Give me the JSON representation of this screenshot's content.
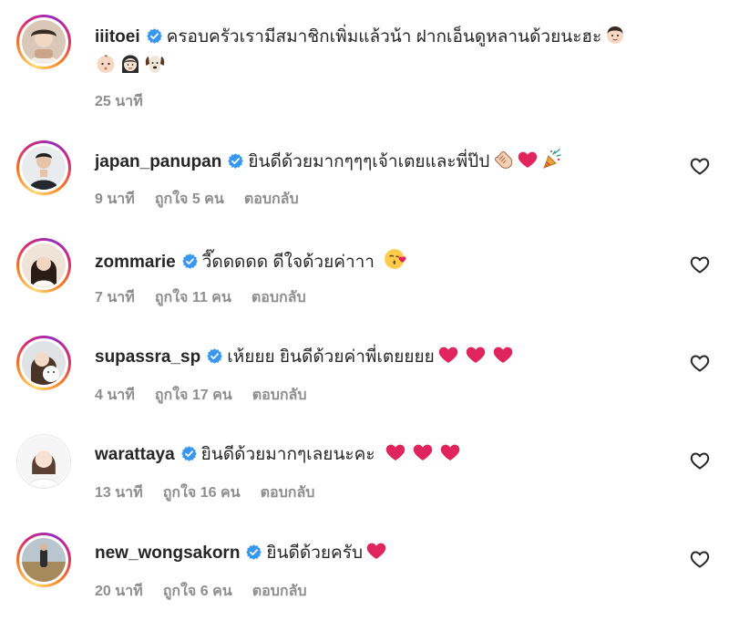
{
  "comments": [
    {
      "username": "iiitoei",
      "text": "ครอบครัวเรามีสมาชิกเพิ่มแล้วน้า ฝากเอ็นดูหลานด้วยนะฮะ",
      "emojis_line1": [
        "man-face-emoji"
      ],
      "emojis_line2": [
        "baby-face-emoji",
        "woman-face-emoji",
        "dog-face-emoji"
      ],
      "time": "25 นาที"
    },
    {
      "username": "japan_panupan",
      "text": "ยินดีด้วยมากๆๆๆเจ้าเตยและพี่ป๊ป",
      "emojis": [
        "clapping-hands-emoji",
        "red-heart-emoji",
        "party-popper-emoji"
      ],
      "time": "9 นาที",
      "likes": "ถูกใจ 5 คน",
      "reply": "ตอบกลับ"
    },
    {
      "username": "zommarie",
      "text": "วี๊ดดดดด ดีใจด้วยค่าาา",
      "emojis": [
        "face-blowing-kiss-emoji"
      ],
      "time": "7 นาที",
      "likes": "ถูกใจ 11 คน",
      "reply": "ตอบกลับ"
    },
    {
      "username": "supassra_sp",
      "text": "เห้ยยย ยินดีด้วยค่าพี่เตยยยย",
      "emojis": [
        "red-heart-emoji",
        "red-heart-emoji",
        "red-heart-emoji"
      ],
      "time": "4 นาที",
      "likes": "ถูกใจ 17 คน",
      "reply": "ตอบกลับ"
    },
    {
      "username": "warattaya",
      "text": "ยินดีด้วยมากๆเลยนะคะ",
      "emojis": [
        "red-heart-emoji",
        "red-heart-emoji",
        "red-heart-emoji"
      ],
      "time": "13 นาที",
      "likes": "ถูกใจ 16 คน",
      "reply": "ตอบกลับ"
    },
    {
      "username": "new_wongsakorn",
      "text": "ยินดีด้วยครับ",
      "emojis": [
        "red-heart-emoji"
      ],
      "time": "20 นาที",
      "likes": "ถูกใจ 6 คน",
      "reply": "ตอบกลับ"
    }
  ],
  "colors": {
    "verified": "#3897f0",
    "meta_gray": "#8e8e8e",
    "heart_red": "#e0245e"
  }
}
